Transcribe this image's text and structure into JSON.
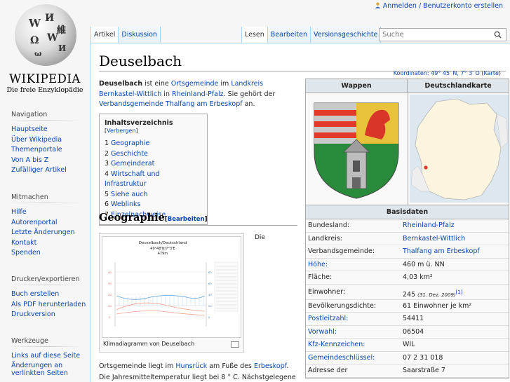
{
  "logo": {
    "wordmark": "WIKIPEDIA",
    "tagline": "Die freie Enzyklopädie"
  },
  "personal": {
    "link": "Anmelden / Benutzerkonto erstellen"
  },
  "tabs_left": [
    "Artikel",
    "Diskussion"
  ],
  "tabs_right": [
    "Lesen",
    "Bearbeiten",
    "Versionsgeschichte"
  ],
  "search": {
    "placeholder": "Suche"
  },
  "sidebar": {
    "navigation": {
      "title": "Navigation",
      "items": [
        "Hauptseite",
        "Über Wikipedia",
        "Themenportale",
        "Von A bis Z",
        "Zufälliger Artikel"
      ]
    },
    "mitmachen": {
      "title": "Mitmachen",
      "items": [
        "Hilfe",
        "Autorenportal",
        "Letzte Änderungen",
        "Kontakt",
        "Spenden"
      ]
    },
    "drucken": {
      "title": "Drucken/exportieren",
      "items": [
        "Buch erstellen",
        "Als PDF herunterladen",
        "Druckversion"
      ]
    },
    "werkzeuge": {
      "title": "Werkzeuge",
      "items": [
        "Links auf diese Seite",
        "Änderungen an verlinkten Seiten"
      ]
    }
  },
  "article": {
    "title": "Deuselbach",
    "coordinates": "Koordinaten: 49° 45′ N, 7° 3′ O",
    "karte": "Karte",
    "intro": {
      "bold": "Deuselbach",
      "t1": " ist eine ",
      "l1": "Ortsgemeinde",
      "t2": " im ",
      "l2": "Landkreis Bernkastel-Wittlich",
      "t3": " in ",
      "l3": "Rheinland-Pfalz",
      "t4": ". Sie gehört der ",
      "l4": "Verbandsgemeinde Thalfang am Erbeskopf",
      "t5": " an."
    },
    "toc": {
      "title": "Inhaltsverzeichnis",
      "toggle": "Verbergen",
      "items": [
        {
          "num": "1",
          "label": "Geographie"
        },
        {
          "num": "2",
          "label": "Geschichte"
        },
        {
          "num": "3",
          "label": "Gemeinderat"
        },
        {
          "num": "4",
          "label": "Wirtschaft und Infrastruktur"
        },
        {
          "num": "5",
          "label": "Siehe auch"
        },
        {
          "num": "6",
          "label": "Weblinks"
        },
        {
          "num": "7",
          "label": "Einzelnachweise"
        }
      ]
    },
    "section_geo": {
      "title": "Geographie",
      "edit": "Bearbeiten"
    },
    "climate": {
      "title": "Deuselbach/Deutschland",
      "coords": "49°48'N/7°3'E",
      "altitude": "479m",
      "caption": "Klimadiagramm von Deuselbach"
    },
    "die": "Die",
    "para2": {
      "t1": "Ortsgemeinde liegt im ",
      "l1": "Hunsrück",
      "t2": " am Fuße des ",
      "l2": "Erbeskopf",
      "t3": ". Die Jahresmitteltemperatur liegt bei 8 ° C. Nächstgelegene"
    }
  },
  "infobox": {
    "wappen": "Wappen",
    "karte": "Deutschlandkarte",
    "basisdaten": "Basisdaten",
    "rows": [
      {
        "k": "Bundesland:",
        "v": "Rheinland-Pfalz",
        "klink": false,
        "vlink": true
      },
      {
        "k": "Landkreis:",
        "v": "Bernkastel-Wittlich",
        "klink": false,
        "vlink": true
      },
      {
        "k": "Verbandsgemeinde:",
        "v": "Thalfang am Erbeskopf",
        "klink": false,
        "vlink": true
      },
      {
        "k": "Höhe:",
        "v": "460 m ü. NN",
        "klink": true,
        "vlink": false
      },
      {
        "k": "Fläche:",
        "v": "4,03 km²",
        "klink": false,
        "vlink": false
      },
      {
        "k": "Einwohner:",
        "v": "245",
        "note": "(31. Dez. 2009)",
        "ref": "[1]",
        "klink": false,
        "vlink": false
      },
      {
        "k": "Bevölkerungsdichte:",
        "v": "61 Einwohner je km²",
        "klink": false,
        "vlink": false
      },
      {
        "k": "Postleitzahl:",
        "v": "54411",
        "klink": true,
        "vlink": false
      },
      {
        "k": "Vorwahl:",
        "v": "06504",
        "klink": true,
        "vlink": false
      },
      {
        "k": "Kfz-Kennzeichen:",
        "v": "WIL",
        "klink": true,
        "vlink": false
      },
      {
        "k": "Gemeindeschlüssel:",
        "v": "07 2 31 018",
        "klink": true,
        "vlink": false
      },
      {
        "k": "Adresse der",
        "v": "Saarstraße 7",
        "klink": false,
        "vlink": false
      }
    ]
  }
}
